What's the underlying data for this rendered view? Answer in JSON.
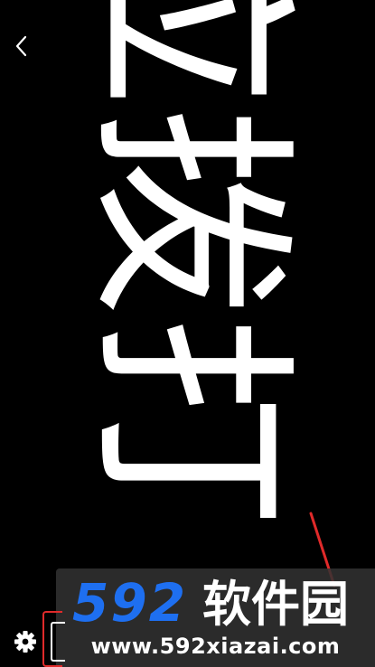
{
  "marquee": {
    "text": "应拨打",
    "color": "#ffffff",
    "background": "#000000"
  },
  "icons": {
    "back": "back-chevron-icon",
    "settings": "gear-icon"
  },
  "annotation": {
    "color": "#e02a2a"
  },
  "watermark": {
    "logo_digits": "592",
    "logo_text": "软件园",
    "url": "www.592xiazai.com",
    "digits_color": "#1e6ff0",
    "text_color": "#ffffff"
  }
}
